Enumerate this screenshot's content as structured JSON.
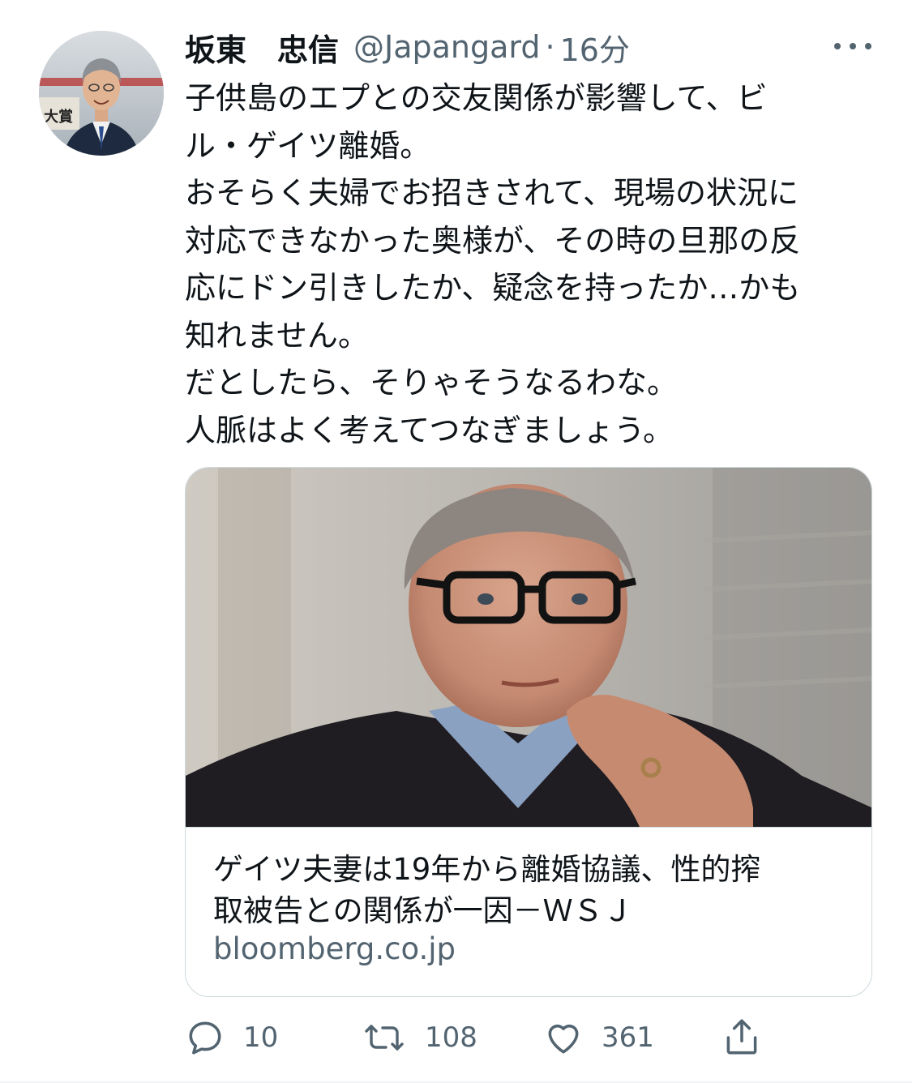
{
  "tweet": {
    "display_name": "坂東　忠信",
    "handle": "@Japangard",
    "separator": "·",
    "time": "16分",
    "text_lines": [
      "子供島のエプとの交友関係が影響して、ビ",
      "ル・ゲイツ離婚。",
      "おそらく夫婦でお招きされて、現場の状況に",
      "対応できなかった奥様が、その時の旦那の反",
      "応にドン引きしたか、疑念を持ったか…かも",
      "知れません。",
      "だとしたら、そりゃそうなるわな。",
      "人脈はよく考えてつなぎましょう。"
    ],
    "avatar_badge": "大賞"
  },
  "card": {
    "title_lines": [
      "ゲイツ夫妻は19年から離婚協議、性的搾",
      "取被告との関係が一因－ＷＳＪ"
    ],
    "domain": "bloomberg.co.jp"
  },
  "actions": {
    "reply": {
      "icon": "reply-icon",
      "count": "10"
    },
    "retweet": {
      "icon": "retweet-icon",
      "count": "108"
    },
    "like": {
      "icon": "heart-icon",
      "count": "361"
    },
    "share": {
      "icon": "share-icon"
    }
  },
  "colors": {
    "text": "#0f1419",
    "secondary": "#536471",
    "border": "#cfd9de"
  }
}
